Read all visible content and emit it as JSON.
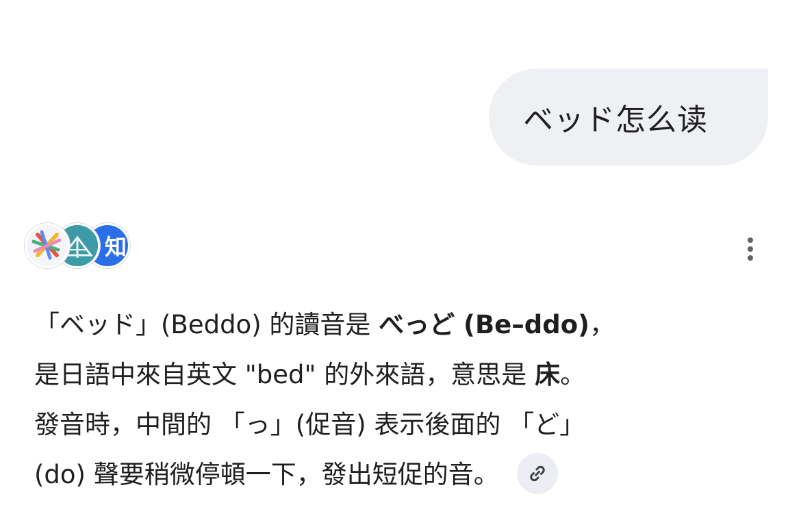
{
  "user_message": {
    "text": "ベッド怎么读"
  },
  "sources": {
    "icons": [
      "colorful-x-logo-icon",
      "teal-book-logo-icon",
      "zhihu-logo-icon"
    ],
    "third_icon_label": "知"
  },
  "more_menu": {
    "icon": "more-vertical-icon"
  },
  "answer": {
    "line1": {
      "p1": "「ベッド」(Beddo) 的讀音是 ",
      "b1": "べっど (Be–ddo)",
      "p2": "，"
    },
    "line2": {
      "p1": "是日語中來自英文 \"bed\" 的外來語，意思是 ",
      "b1": "床",
      "p2": "。"
    },
    "line3": {
      "p1": "發音時，中間的 「っ」(促音) 表示後面的 「ど」"
    },
    "line4": {
      "p1": "(do) 聲要稍微停頓一下，發出短促的音。"
    },
    "link_icon": "link-icon"
  },
  "colors": {
    "bubble_bg": "#eef0f4",
    "text": "#1f1f1f",
    "link_btn_bg": "#eceef3",
    "zhihu_blue": "#2b6fe8",
    "teal": "#3d9aa6"
  }
}
